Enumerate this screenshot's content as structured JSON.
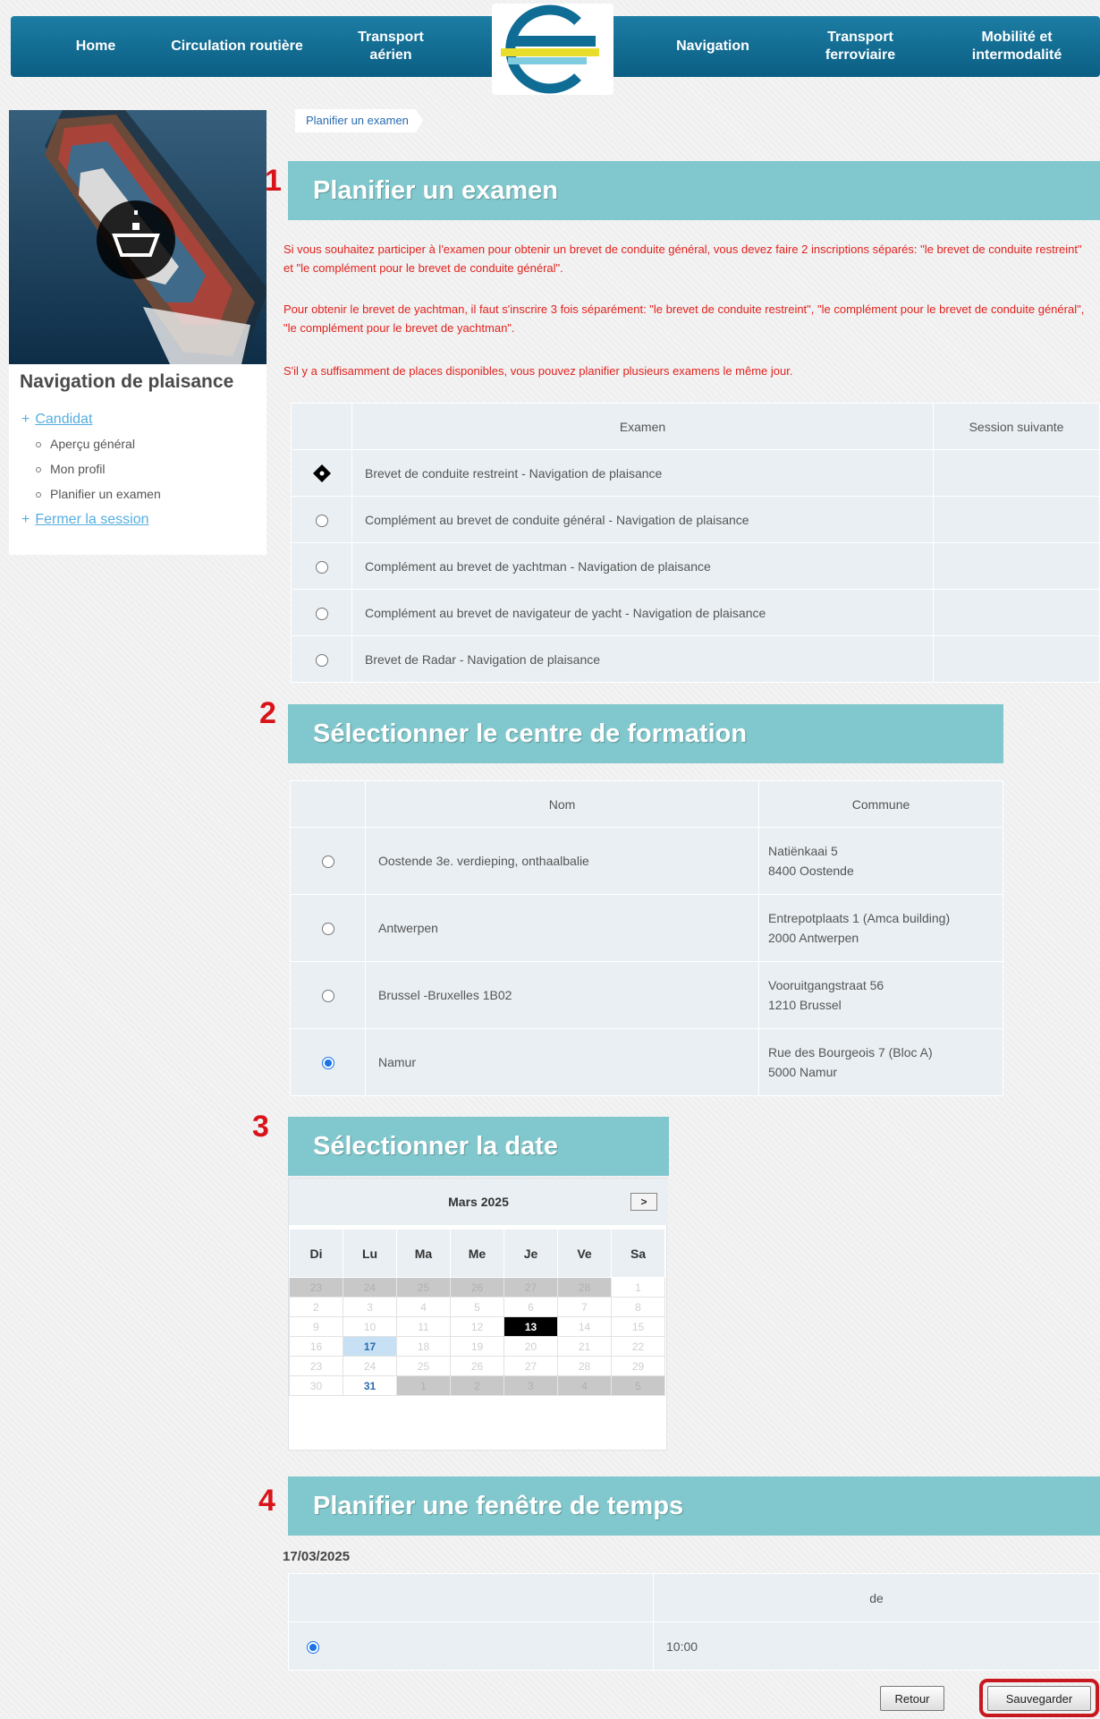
{
  "nav": {
    "items": [
      {
        "label": "Home"
      },
      {
        "label": "Circulation routière"
      },
      {
        "label": "Transport\naérien"
      },
      {
        "label": "Navigation"
      },
      {
        "label": "Transport\nferroviaire"
      },
      {
        "label": "Mobilité et\nintermodalité"
      }
    ]
  },
  "sidebar": {
    "title": "Navigation de plaisance",
    "candidat_label": "Candidat",
    "sub_items": [
      "Aperçu général",
      "Mon profil",
      "Planifier un examen"
    ],
    "close_label": "Fermer la session"
  },
  "breadcrumb": {
    "label": "Planifier un examen"
  },
  "steps": [
    "1",
    "2",
    "3",
    "4"
  ],
  "section1": {
    "title": "Planifier un examen",
    "notes": [
      "Si vous souhaitez participer à l'examen pour obtenir un brevet de conduite général, vous devez faire 2 inscriptions séparés: \"le brevet de conduite restreint\" et \"le complément pour le brevet de conduite général\".",
      "Pour obtenir le brevet de yachtman, il faut s'inscrire 3 fois séparément: \"le brevet de conduite restreint\", \"le complément pour le brevet de conduite général\", \"le complément pour le brevet de yachtman\".",
      "S'il y a suffisamment de places disponibles, vous pouvez planifier plusieurs examens le même jour."
    ],
    "columns": [
      "",
      "Examen",
      "Session suivante"
    ],
    "rows": [
      {
        "exam": "Brevet de conduite restreint - Navigation de plaisance",
        "session": "",
        "selected": true
      },
      {
        "exam": "Complément au brevet de conduite général - Navigation de plaisance",
        "session": "",
        "selected": false
      },
      {
        "exam": "Complément au brevet de yachtman - Navigation de plaisance",
        "session": "",
        "selected": false
      },
      {
        "exam": "Complément au brevet de navigateur de yacht - Navigation de plaisance",
        "session": "",
        "selected": false
      },
      {
        "exam": "Brevet de Radar - Navigation de plaisance",
        "session": "",
        "selected": false
      }
    ]
  },
  "section2": {
    "title": "Sélectionner le centre de formation",
    "columns": [
      "",
      "Nom",
      "Commune"
    ],
    "rows": [
      {
        "name": "Oostende 3e. verdieping, onthaalbalie",
        "addr1": "Natiënkaai 5",
        "addr2": "8400 Oostende",
        "selected": false
      },
      {
        "name": "Antwerpen",
        "addr1": "Entrepotplaats 1 (Amca building)",
        "addr2": "2000 Antwerpen",
        "selected": false
      },
      {
        "name": "Brussel -Bruxelles 1B02",
        "addr1": "Vooruitgangstraat 56",
        "addr2": "1210 Brussel",
        "selected": false
      },
      {
        "name": "Namur",
        "addr1": "Rue des Bourgeois 7 (Bloc A)",
        "addr2": "5000 Namur",
        "selected": true
      }
    ]
  },
  "section3": {
    "title": "Sélectionner la date",
    "month": "Mars 2025",
    "next_label": ">",
    "weekdays": [
      "Di",
      "Lu",
      "Ma",
      "Me",
      "Je",
      "Ve",
      "Sa"
    ],
    "weeks": [
      [
        "23",
        "24",
        "25",
        "26",
        "27",
        "28",
        "1"
      ],
      [
        "2",
        "3",
        "4",
        "5",
        "6",
        "7",
        "8"
      ],
      [
        "9",
        "10",
        "11",
        "12",
        "13",
        "14",
        "15"
      ],
      [
        "16",
        "17",
        "18",
        "19",
        "20",
        "21",
        "22"
      ],
      [
        "23",
        "24",
        "25",
        "26",
        "27",
        "28",
        "29"
      ],
      [
        "30",
        "31",
        "1",
        "2",
        "3",
        "4",
        "5"
      ]
    ]
  },
  "section4": {
    "title": "Planifier une fenêtre de temps",
    "date": "17/03/2025",
    "columns": [
      "",
      "de"
    ],
    "rows": [
      {
        "time": "10:00",
        "selected": true
      }
    ]
  },
  "buttons": {
    "back": "Retour",
    "save": "Sauvegarder"
  },
  "colors": {
    "nav": "#0b5e83",
    "section_header": "#80c8cd",
    "note_text": "#e2221d",
    "highlight": "#c8181f",
    "link": "#55aee0"
  }
}
